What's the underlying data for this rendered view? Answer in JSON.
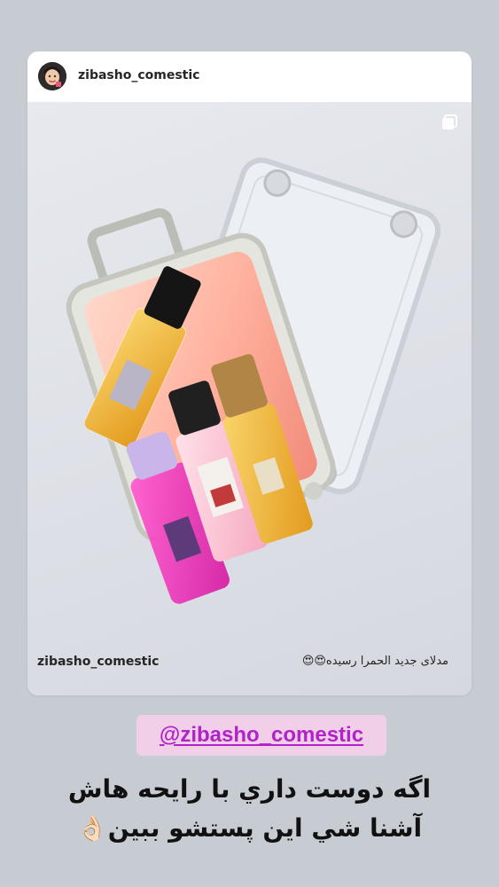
{
  "post": {
    "header_username": "zibasho_comestic",
    "footer_username": "zibasho_comestic",
    "caption": "مدلای جدید الحمرا رسیده😍😍"
  },
  "story": {
    "mention": "@zibasho_comestic",
    "line1": "اگه دوست داري با رايحه هاش",
    "line2": "آشنا شي اين پستشو ببين👌🏻"
  },
  "icons": {
    "multi_photo": "multiple-photos-icon",
    "mention": "threads-icon"
  },
  "colors": {
    "background": "#c7ccd2",
    "mention_bg": "#f2cfe9",
    "mention_text": "#b123c8"
  }
}
